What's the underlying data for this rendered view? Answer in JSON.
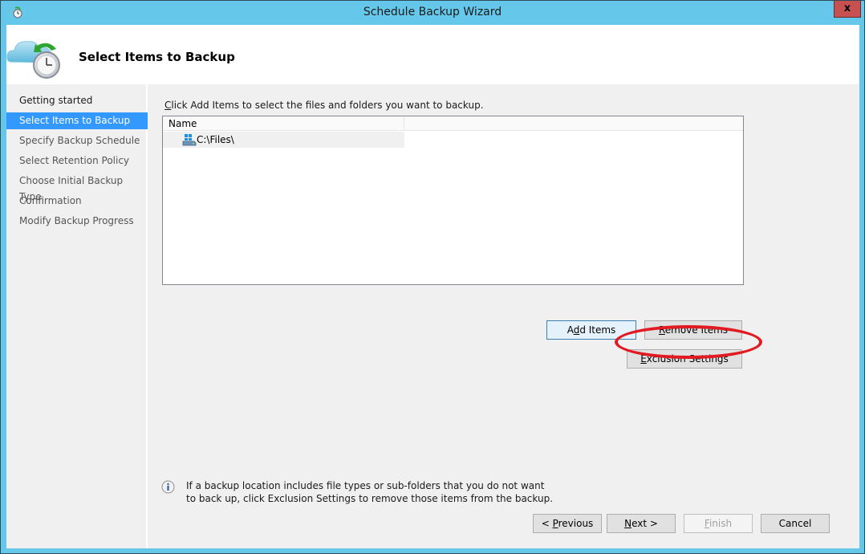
{
  "window": {
    "title": "Schedule Backup Wizard",
    "close_label": "x",
    "title_icon": "backup-schedule-icon"
  },
  "header": {
    "title": "Select Items to Backup",
    "icon": "cloud-backup-clock-icon"
  },
  "sidebar": {
    "steps": [
      {
        "label": "Getting started",
        "state": "completed"
      },
      {
        "label": "Select Items to Backup",
        "state": "active"
      },
      {
        "label": "Specify Backup Schedule",
        "state": "pending"
      },
      {
        "label": "Select Retention Policy",
        "state": "pending"
      },
      {
        "label": "Choose Initial Backup Type",
        "state": "pending"
      },
      {
        "label": "Confirmation",
        "state": "pending"
      },
      {
        "label": "Modify Backup Progress",
        "state": "pending"
      }
    ]
  },
  "main": {
    "instruction_accel": "C",
    "instruction_rest": "lick Add Items to select the files and folders you want to backup.",
    "list": {
      "columns": [
        "Name"
      ],
      "items": [
        {
          "name": "C:\\Files\\",
          "icon": "drive-icon"
        }
      ]
    },
    "buttons": {
      "add_items": {
        "pre": "A",
        "accel": "d",
        "post": "d Items"
      },
      "remove_items": {
        "pre": "",
        "accel": "R",
        "post": "emove Items"
      },
      "exclusion_settings": {
        "pre": "",
        "accel": "E",
        "post": "xclusion Settings"
      }
    },
    "annotation_color": "#e21b23",
    "info_text": "If a backup location includes file types or sub-folders that you do not want to back up, click Exclusion Settings to remove those items from the backup."
  },
  "footer": {
    "previous": {
      "pre": "< ",
      "accel": "P",
      "post": "revious"
    },
    "next": {
      "pre": "",
      "accel": "N",
      "post": "ext >"
    },
    "finish": {
      "pre": "",
      "accel": "F",
      "post": "inish",
      "enabled": false
    },
    "cancel": "Cancel"
  },
  "colors": {
    "window_frame": "#65c7e9",
    "active_step": "#3399ff",
    "close_button": "#c75050"
  }
}
